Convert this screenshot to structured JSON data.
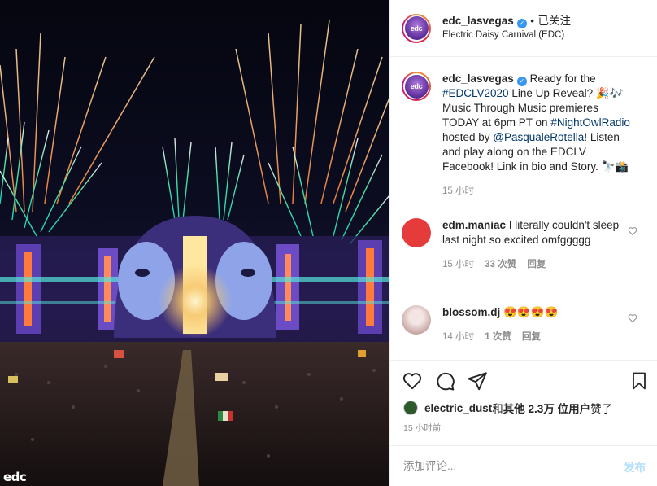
{
  "photo": {
    "watermark": "edc"
  },
  "header": {
    "username": "edc_lasvegas",
    "dot": "•",
    "follow_label": "已关注",
    "subtitle": "Electric Daisy Carnival (EDC)",
    "avatar_text": "edc"
  },
  "caption": {
    "username": "edc_lasvegas",
    "text_before": " Ready for the ",
    "hashtag1": "#EDCLV2020",
    "text_mid1": " Line Up Reveal? 🎉🎶 Music Through Music premieres TODAY at 6pm PT on ",
    "hashtag2": "#NightOwlRadio",
    "text_mid2": " hosted by ",
    "mention": "@PasqualeRotella",
    "text_after": "! Listen and play along on the EDCLV Facebook! Link in bio and Story. 🔭📸",
    "time": "15 小时"
  },
  "comments": [
    {
      "username": "edm.maniac",
      "text": " I literally couldn't sleep last night so excited omfggggg",
      "time": "15 小时",
      "likes": "33 次赞",
      "reply": "回复",
      "avatar_color": "#e63b3b"
    },
    {
      "username": "blossom.dj",
      "text": " 😍😍😍😍",
      "time": "14 小时",
      "likes": "1 次赞",
      "reply": "回复",
      "avatar_color": "#d9c3c0"
    }
  ],
  "likes": {
    "username": "electric_dust",
    "and": " 和 ",
    "others": "其他 2.3万 位用户",
    "liked": " 赞了"
  },
  "posted_ago": "15 小时前",
  "comment_box": {
    "placeholder": "添加评论...",
    "post_label": "发布"
  },
  "icons": {
    "verified": "verified-badge-icon",
    "like": "heart-icon",
    "comment": "comment-icon",
    "share": "share-icon",
    "save": "bookmark-icon"
  }
}
